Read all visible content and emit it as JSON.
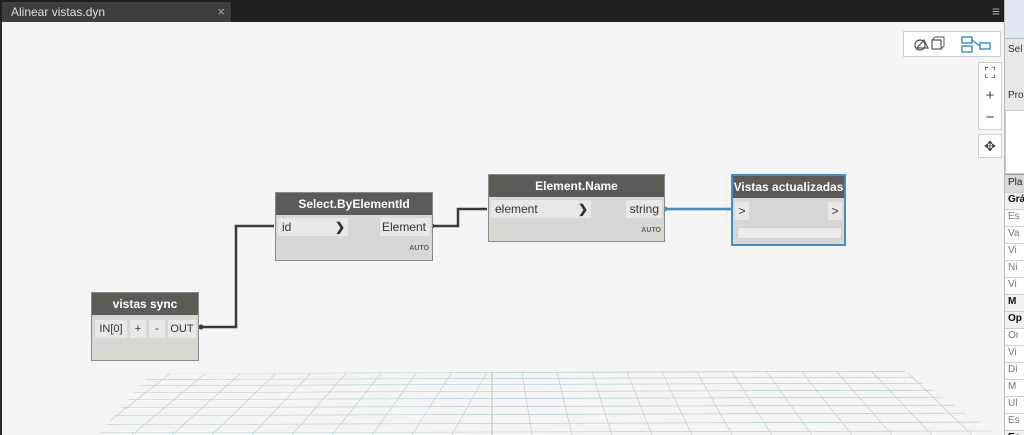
{
  "tab": {
    "title": "Alinear vistas.dyn",
    "close": "×"
  },
  "menu_icon": "≡",
  "view_toggle": {
    "left_icon": "3d-preview-icon",
    "right_icon": "graph-view-icon",
    "active": "graph"
  },
  "zoom": {
    "fit": "⛶",
    "zoom_in": "+",
    "zoom_out": "−",
    "pan": "✥"
  },
  "nodes": {
    "vistas_sync": {
      "title": "vistas sync",
      "in_label": "IN[0]",
      "plus": "+",
      "minus": "-",
      "out_label": "OUT"
    },
    "select_by_id": {
      "title": "Select.ByElementId",
      "input": "id",
      "output": "Element",
      "lacing": "AUTO"
    },
    "element_name": {
      "title": "Element.Name",
      "input": "element",
      "output": "string",
      "lacing": "AUTO"
    },
    "watch": {
      "title": "Vistas actualizadas",
      "input": ">",
      "output": ">"
    }
  },
  "right_panel": {
    "top_label": "Sel",
    "section_label": "Pro",
    "header": "Pla",
    "rows": [
      {
        "text": "Grá",
        "bold": true
      },
      {
        "text": "Es",
        "bold": false
      },
      {
        "text": "Va",
        "bold": false
      },
      {
        "text": "Vi",
        "bold": false
      },
      {
        "text": "Ni",
        "bold": false
      },
      {
        "text": "Vi",
        "bold": false
      },
      {
        "text": "M",
        "bold": true
      },
      {
        "text": "Op",
        "bold": true
      },
      {
        "text": "Or",
        "bold": false
      },
      {
        "text": "Vi",
        "bold": false
      },
      {
        "text": "Di",
        "bold": false
      },
      {
        "text": "M",
        "bold": false
      },
      {
        "text": "Ul",
        "bold": false
      },
      {
        "text": "Es",
        "bold": false
      },
      {
        "text": "Es",
        "bold": true
      }
    ]
  },
  "colors": {
    "node_header": "#5e5b57",
    "node_body": "#d8d7d2",
    "selected_border": "#3d8fd1",
    "wire": "#3a3a3a",
    "wire_selected": "#3d8fd1"
  }
}
